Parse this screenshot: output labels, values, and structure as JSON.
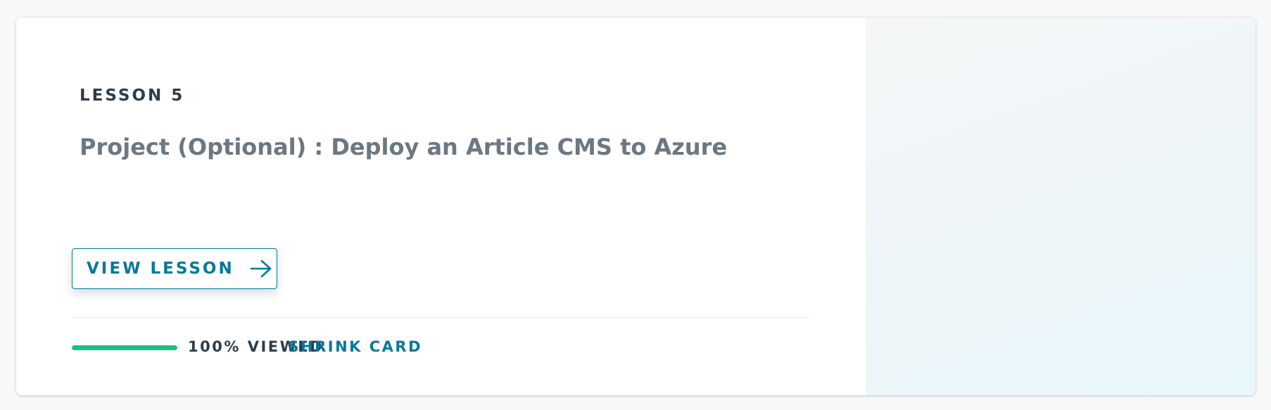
{
  "lesson": {
    "eyebrow": "LESSON 5",
    "title": "Project (Optional) : Deploy an Article CMS to Azure"
  },
  "actions": {
    "view_lesson_label": "VIEW LESSON",
    "view_lesson_icon": "arrow-right-icon",
    "shrink_card_label": "SHRINK CARD"
  },
  "progress": {
    "percent": 100,
    "label": "100% VIEWED"
  },
  "colors": {
    "accent": "#02799b",
    "progress": "#18c17f",
    "text_dark": "#2e3d49",
    "text_muted": "#6b7883"
  }
}
